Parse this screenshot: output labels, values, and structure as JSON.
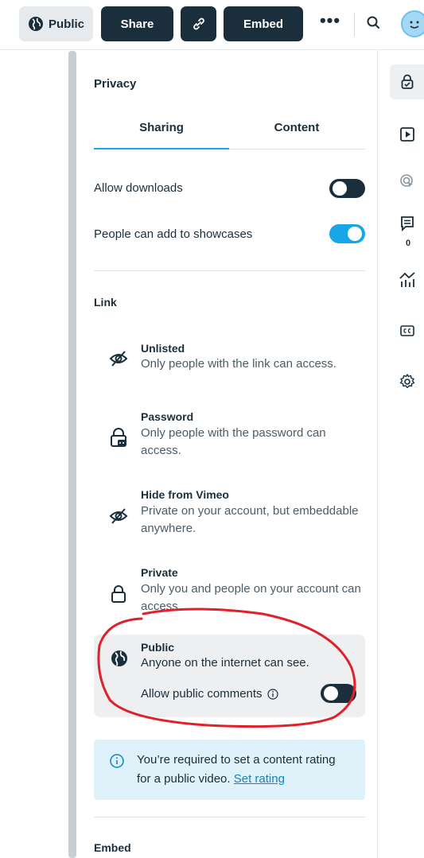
{
  "toolbar": {
    "public_label": "Public",
    "share_label": "Share",
    "embed_label": "Embed",
    "more_label": "•••"
  },
  "icons": {
    "public": "globe-icon",
    "link": "link-icon",
    "search": "search-icon",
    "avatar": "avatar"
  },
  "panel": {
    "title": "Privacy",
    "tabs": [
      {
        "label": "Sharing",
        "active": true
      },
      {
        "label": "Content",
        "active": false
      }
    ],
    "toggles": [
      {
        "label": "Allow downloads",
        "on": false
      },
      {
        "label": "People can add to showcases",
        "on": true
      }
    ],
    "link_section": "Link",
    "options": [
      {
        "name": "Unlisted",
        "desc": "Only people with the link can access.",
        "icon": "eye-slash-icon"
      },
      {
        "name": "Password",
        "desc": "Only people with the password can access.",
        "icon": "lock-key-icon"
      },
      {
        "name": "Hide from Vimeo",
        "desc": "Private on your account, but embeddable anywhere.",
        "icon": "eye-slash-icon"
      },
      {
        "name": "Private",
        "desc": "Only you and people on your account can access.",
        "icon": "lock-icon"
      }
    ],
    "public_option": {
      "name": "Public",
      "desc": "Anyone on the internet can see.",
      "comments_label": "Allow public comments",
      "comments_on": false,
      "selected": true
    },
    "notice": {
      "text": "You’re required to set a content rating for a public video.",
      "link": "Set rating"
    },
    "embed_section": "Embed"
  },
  "rail": {
    "comments_count": "0",
    "items": [
      "lock-check-icon",
      "play-icon",
      "interaction-icon",
      "comments-icon",
      "analytics-icon",
      "captions-icon",
      "settings-icon"
    ]
  },
  "colors": {
    "dark": "#1a2e3b",
    "accent": "#17a7e6",
    "annotation": "#e0202a"
  }
}
